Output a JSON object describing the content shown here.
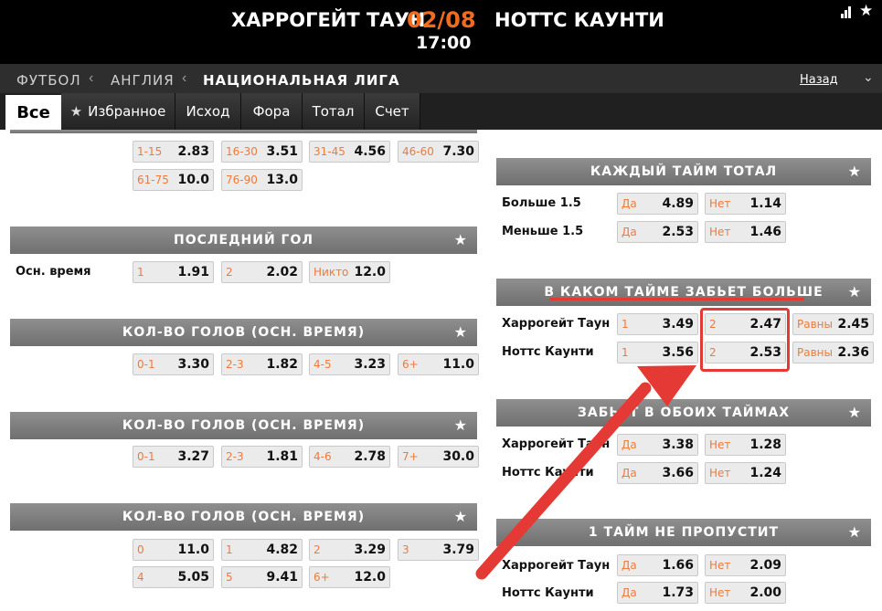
{
  "header": {
    "home_team": "ХАРРОГЕЙТ ТАУН",
    "date": "02/08",
    "away_team": "НОТТС КАУНТИ",
    "time": "17:00"
  },
  "breadcrumb": {
    "items": [
      "ФУТБОЛ",
      "АНГЛИЯ",
      "НАЦИОНАЛЬНАЯ ЛИГА"
    ],
    "back": "Назад"
  },
  "tabs": [
    "Все",
    "Избранное",
    "Исход",
    "Фора",
    "Тотал",
    "Счет"
  ],
  "colors": {
    "accent": "#f26b1d",
    "odd_label": "#ef7a3a",
    "highlight": "#e53935"
  },
  "left": {
    "goal_interval": [
      {
        "l": "1-15",
        "v": "2.83"
      },
      {
        "l": "16-30",
        "v": "3.51"
      },
      {
        "l": "31-45",
        "v": "4.56"
      },
      {
        "l": "46-60",
        "v": "7.30"
      },
      {
        "l": "61-75",
        "v": "10.0"
      },
      {
        "l": "76-90",
        "v": "13.0"
      }
    ],
    "last_goal": {
      "title": "ПОСЛЕДНИЙ ГОЛ",
      "row_label": "Осн. время",
      "odds": [
        {
          "l": "1",
          "v": "1.91"
        },
        {
          "l": "2",
          "v": "2.02"
        },
        {
          "l": "Никто",
          "v": "12.0"
        }
      ]
    },
    "goals1": {
      "title": "КОЛ-ВО ГОЛОВ (ОСН. ВРЕМЯ)",
      "odds": [
        {
          "l": "0-1",
          "v": "3.30"
        },
        {
          "l": "2-3",
          "v": "1.82"
        },
        {
          "l": "4-5",
          "v": "3.23"
        },
        {
          "l": "6+",
          "v": "11.0"
        }
      ]
    },
    "goals2": {
      "title": "КОЛ-ВО ГОЛОВ (ОСН. ВРЕМЯ)",
      "odds": [
        {
          "l": "0-1",
          "v": "3.27"
        },
        {
          "l": "2-3",
          "v": "1.81"
        },
        {
          "l": "4-6",
          "v": "2.78"
        },
        {
          "l": "7+",
          "v": "30.0"
        }
      ]
    },
    "goals3": {
      "title": "КОЛ-ВО ГОЛОВ (ОСН. ВРЕМЯ)",
      "odds": [
        {
          "l": "0",
          "v": "11.0"
        },
        {
          "l": "1",
          "v": "4.82"
        },
        {
          "l": "2",
          "v": "3.29"
        },
        {
          "l": "3",
          "v": "3.79"
        },
        {
          "l": "4",
          "v": "5.05"
        },
        {
          "l": "5",
          "v": "9.41"
        },
        {
          "l": "6+",
          "v": "12.0"
        }
      ]
    }
  },
  "right": {
    "each_half_total": {
      "title": "КАЖДЫЙ ТАЙМ ТОТАЛ",
      "rows": [
        {
          "label": "Больше 1.5",
          "odds": [
            {
              "l": "Да",
              "v": "4.89"
            },
            {
              "l": "Нет",
              "v": "1.14"
            }
          ]
        },
        {
          "label": "Меньше 1.5",
          "odds": [
            {
              "l": "Да",
              "v": "2.53"
            },
            {
              "l": "Нет",
              "v": "1.46"
            }
          ]
        }
      ]
    },
    "which_half": {
      "title": "В КАКОМ ТАЙМЕ ЗАБЬЕТ БОЛЬШЕ",
      "rows": [
        {
          "label": "Харрогейт Таун",
          "odds": [
            {
              "l": "1",
              "v": "3.49"
            },
            {
              "l": "2",
              "v": "2.47"
            },
            {
              "l": "Равны",
              "v": "2.45"
            }
          ]
        },
        {
          "label": "Ноттс Каунти",
          "odds": [
            {
              "l": "1",
              "v": "3.56"
            },
            {
              "l": "2",
              "v": "2.53"
            },
            {
              "l": "Равны",
              "v": "2.36"
            }
          ]
        }
      ]
    },
    "both_halves": {
      "title": "ЗАБЬЕТ В ОБОИХ ТАЙМАХ",
      "rows": [
        {
          "label": "Харрогейт Таун",
          "odds": [
            {
              "l": "Да",
              "v": "3.38"
            },
            {
              "l": "Нет",
              "v": "1.28"
            }
          ]
        },
        {
          "label": "Ноттс Каунти",
          "odds": [
            {
              "l": "Да",
              "v": "3.66"
            },
            {
              "l": "Нет",
              "v": "1.24"
            }
          ]
        }
      ]
    },
    "first_half_clean": {
      "title": "1 ТАЙМ НЕ ПРОПУСТИТ",
      "rows": [
        {
          "label": "Харрогейт Таун",
          "odds": [
            {
              "l": "Да",
              "v": "1.66"
            },
            {
              "l": "Нет",
              "v": "2.09"
            }
          ]
        },
        {
          "label": "Ноттс Каунти",
          "odds": [
            {
              "l": "Да",
              "v": "1.73"
            },
            {
              "l": "Нет",
              "v": "2.00"
            }
          ]
        }
      ]
    }
  }
}
